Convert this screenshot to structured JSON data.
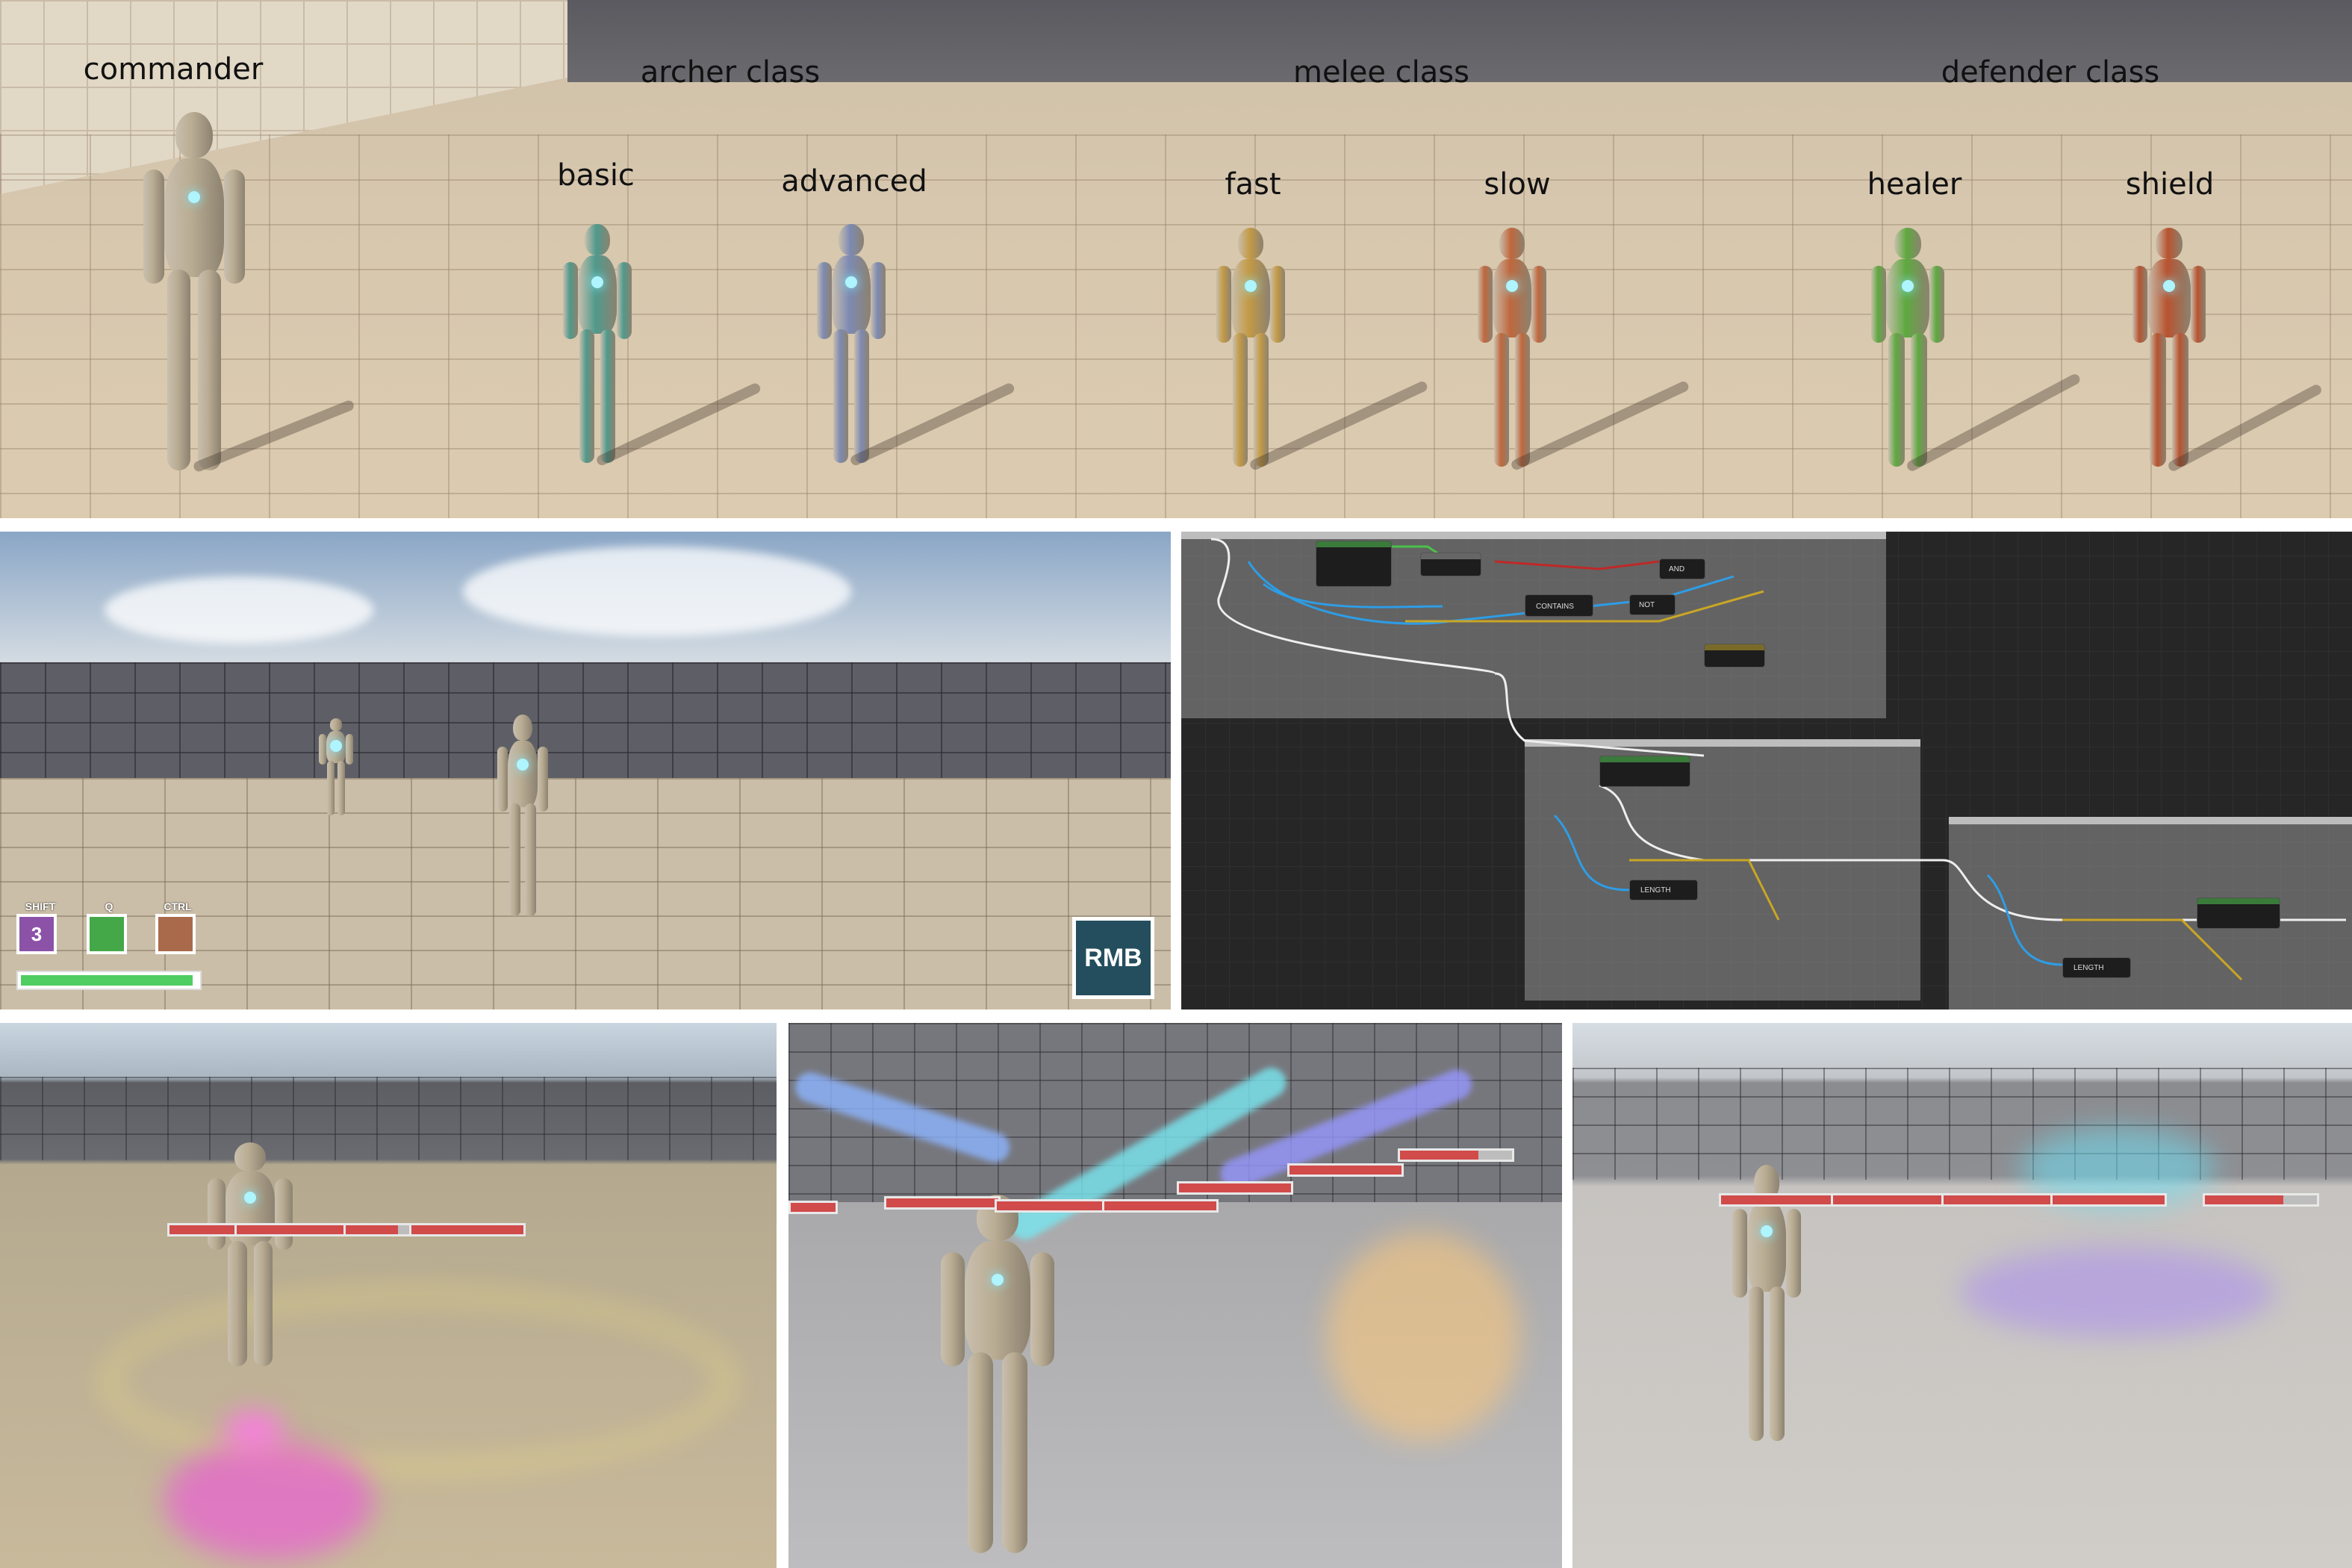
{
  "lineup": {
    "labels": {
      "commander": "commander",
      "archer_class": "archer class",
      "basic": "basic",
      "advanced": "advanced",
      "melee_class": "melee class",
      "fast": "fast",
      "slow": "slow",
      "defender_class": "defender class",
      "healer": "healer",
      "shield": "shield"
    },
    "colors": {
      "commander": "#b9ac93",
      "basic": "#4f9a8c",
      "advanced": "#7d8ab3",
      "fast": "#c49a45",
      "slow": "#c0673c",
      "healer": "#5ea93f",
      "shield": "#b8532f"
    }
  },
  "arena_hud": {
    "shift_label": "SHIFT",
    "q_label": "Q",
    "ctrl_label": "CTRL",
    "shift_value": "3",
    "shift_color": "#8b52a8",
    "q_color": "#45a848",
    "ctrl_color": "#a86a4a",
    "rmb_label": "RMB",
    "health_fraction": 0.96
  },
  "blueprint": {
    "node_labels": {
      "contains": "CONTAINS",
      "not": "NOT",
      "and": "AND",
      "length1": "LENGTH",
      "length2": "LENGTH"
    }
  }
}
